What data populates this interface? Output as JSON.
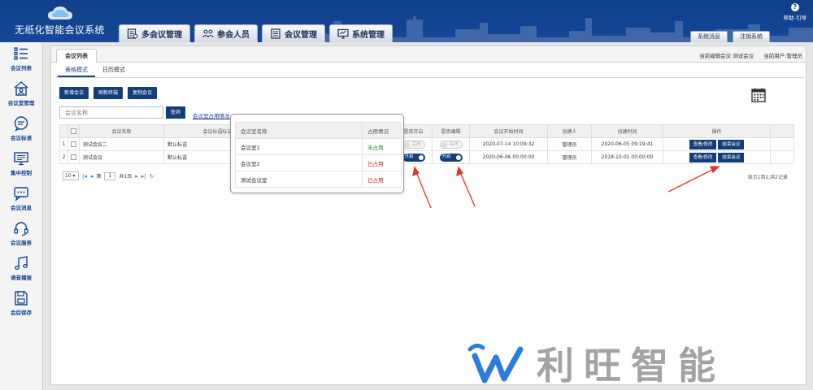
{
  "app": {
    "title": "无纸化智能会议系统"
  },
  "nav": [
    {
      "label": "多会议管理",
      "icon": "multi-meeting-icon"
    },
    {
      "label": "参会人员",
      "icon": "attendees-icon"
    },
    {
      "label": "会议管理",
      "icon": "meeting-manage-icon"
    },
    {
      "label": "系统管理",
      "icon": "system-manage-icon"
    }
  ],
  "header": {
    "help": "帮助-引导",
    "sys_msg": "系统消息",
    "logout": "注销系统"
  },
  "sidebar": [
    {
      "label": "会议列表",
      "icon": "list-icon"
    },
    {
      "label": "会议室管理",
      "icon": "room-icon"
    },
    {
      "label": "会议标语",
      "icon": "chat-icon"
    },
    {
      "label": "集中控制",
      "icon": "monitor-icon"
    },
    {
      "label": "会议消息",
      "icon": "message-icon"
    },
    {
      "label": "会议服务",
      "icon": "headset-icon"
    },
    {
      "label": "语音播报",
      "icon": "music-icon"
    },
    {
      "label": "会后保存",
      "icon": "save-icon"
    }
  ],
  "main": {
    "tab": "会议列表",
    "current_meeting": "当前编辑会议:测试会议",
    "current_user": "当前用户:管理员",
    "views": [
      "表格模式",
      "日历模式"
    ],
    "actions": [
      "新增会议",
      "刷新终端",
      "复制会议"
    ],
    "search_placeholder": "会议名称",
    "search_btn": "查询",
    "room_link": "会议室占用情况"
  },
  "table": {
    "headers": [
      "",
      "",
      "会议名称",
      "会议标语标记",
      "",
      "是否开启",
      "是否编辑",
      "会议开始时间",
      "创建人",
      "创建时间",
      "操作",
      ""
    ],
    "rows": [
      {
        "no": "1",
        "name": "测试会议二",
        "slogan": "默认标语",
        "open": "关闭",
        "edit": "关闭",
        "start": "2020-07-14 10:09:32",
        "creator": "管理员",
        "created": "2020-06-05 09:19:41",
        "op1": "查看/修改",
        "op2": "结束会议"
      },
      {
        "no": "2",
        "name": "测试会议",
        "slogan": "默认标语",
        "open": "开启",
        "edit": "开启",
        "start": "2020-06-06 00:00:00",
        "creator": "管理员",
        "created": "2018-10-01 00:00:00",
        "op1": "查看/修改",
        "op2": "结束会议"
      }
    ]
  },
  "pager": {
    "size": "10",
    "page_label": "第",
    "page": "1",
    "total_label": "共1页",
    "info": "显示1到2,共2记录"
  },
  "popup": {
    "headers": [
      "会议室名称",
      "占用情况"
    ],
    "rows": [
      {
        "name": "会议室1",
        "status": "未占用",
        "state": "free"
      },
      {
        "name": "会议室2",
        "status": "已占用",
        "state": "used"
      },
      {
        "name": "测试会议室",
        "status": "已占用",
        "state": "used"
      }
    ]
  },
  "brand": {
    "text": "利旺智能",
    "color": "#2a7de0"
  }
}
